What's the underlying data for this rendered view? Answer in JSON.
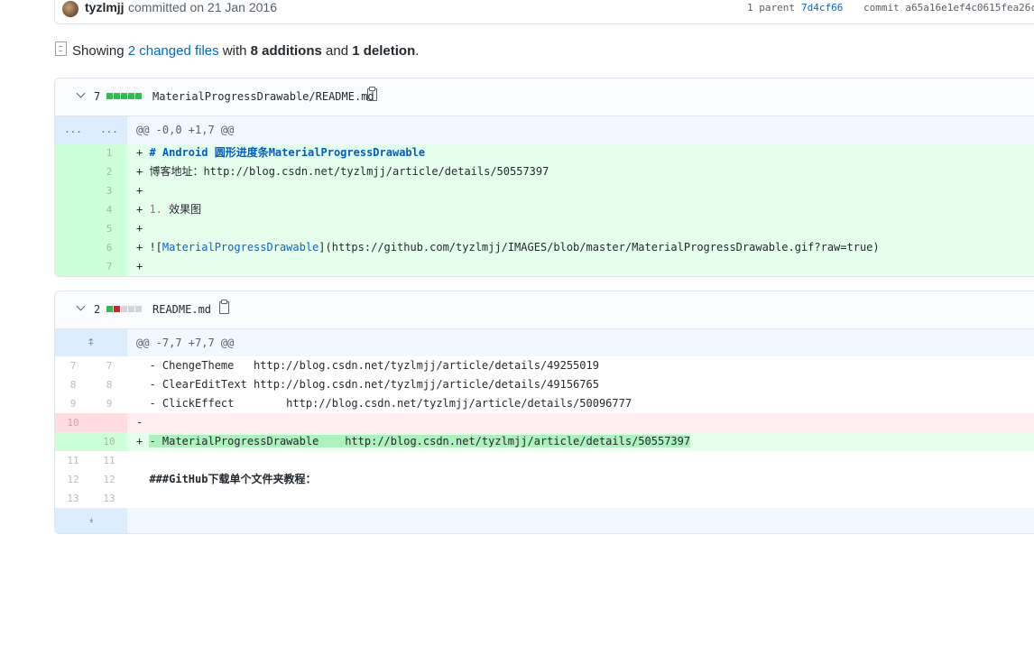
{
  "commit_bar": {
    "author": "tyzlmjj",
    "committed_text": "committed on 21 Jan 2016",
    "parent_label": "1 parent",
    "parent_hash": "7d4cf66",
    "commit_label": "commit a65a16e1ef4c0615fea26c"
  },
  "summary": {
    "prefix": "Showing",
    "changed_files": "2 changed files",
    "with": "with",
    "additions": "8 additions",
    "and": "and",
    "deletions": "1 deletion",
    "suffix": "."
  },
  "files": [
    {
      "count": "7",
      "name": "MaterialProgressDrawable/README.md",
      "hunk": "@@ -0,0 +1,7 @@",
      "hunk_gutter": [
        "...",
        "..."
      ],
      "lines": [
        {
          "new": "1",
          "pre": "+ ",
          "a": "# Android ",
          "b": "圆形进度条MaterialProgressDrawable"
        },
        {
          "new": "2",
          "pre": "+ ",
          "a": "博客地址：http://blog.csdn.net/tyzlmjj/article/details/50557397"
        },
        {
          "new": "3",
          "pre": "+",
          "a": ""
        },
        {
          "new": "4",
          "pre": "+ ",
          "num": "1.",
          "a": " 效果图"
        },
        {
          "new": "5",
          "pre": "+",
          "a": ""
        },
        {
          "new": "6",
          "pre": "+ ",
          "a": "![",
          "link": "MaterialProgressDrawable",
          "b": "](https://github.com/tyzlmjj/IMAGES/blob/master/MaterialProgressDrawable.gif?raw=true)"
        },
        {
          "new": "7",
          "pre": "+",
          "a": ""
        }
      ]
    },
    {
      "count": "2",
      "name": "README.md",
      "hunk": "@@ -7,7 +7,7 @@",
      "lines": [
        {
          "old": "7",
          "new": "7",
          "text": "  - ChengeTheme   http://blog.csdn.net/tyzlmjj/article/details/49255019"
        },
        {
          "old": "8",
          "new": "8",
          "text": "  - ClearEditText http://blog.csdn.net/tyzlmjj/article/details/49156765"
        },
        {
          "old": "9",
          "new": "9",
          "text": "  - ClickEffect        http://blog.csdn.net/tyzlmjj/article/details/50096777"
        },
        {
          "old": "10",
          "new": "",
          "text": "-"
        },
        {
          "old": "",
          "new": "10",
          "pre": "+ ",
          "text": "- MaterialProgressDrawable    http://blog.csdn.net/tyzlmjj/article/details/50557397"
        },
        {
          "old": "11",
          "new": "11",
          "text": ""
        },
        {
          "old": "12",
          "new": "12",
          "text": "  ###GitHub下载单个文件夹教程："
        },
        {
          "old": "13",
          "new": "13",
          "text": ""
        }
      ]
    }
  ]
}
